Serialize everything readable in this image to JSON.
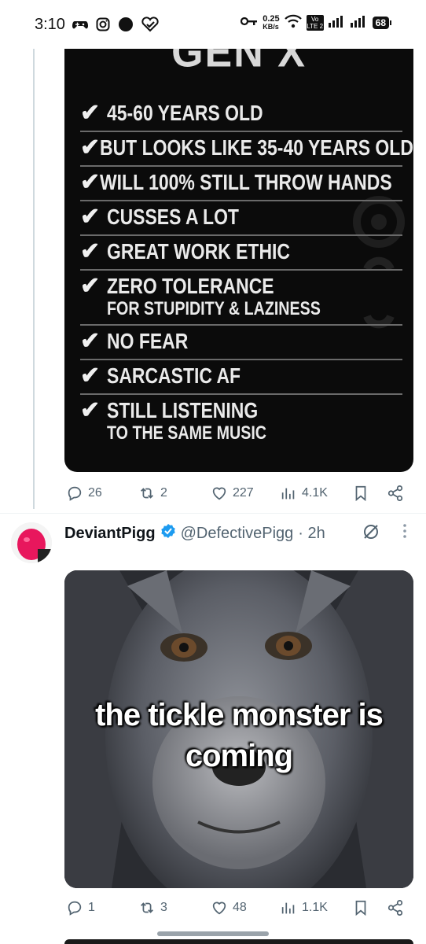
{
  "status_bar": {
    "time": "3:10",
    "net_speed": "0.25\nKB/s",
    "net_speed_value": "0.25",
    "net_speed_unit": "KB/s",
    "volte": "Vo LTE 2",
    "battery": "68"
  },
  "tweet1": {
    "image_heading": "GEN X DEFINED",
    "list": [
      {
        "main": "45-60 YEARS OLD",
        "sub": ""
      },
      {
        "main": "BUT LOOKS LIKE 35-40 YEARS OLD",
        "sub": ""
      },
      {
        "main": "WILL 100% STILL THROW HANDS",
        "sub": ""
      },
      {
        "main": "CUSSES A LOT",
        "sub": ""
      },
      {
        "main": "GREAT WORK ETHIC",
        "sub": ""
      },
      {
        "main": "ZERO TOLERANCE",
        "sub": "FOR STUPIDITY & LAZINESS"
      },
      {
        "main": "NO FEAR",
        "sub": ""
      },
      {
        "main": "SARCASTIC AF",
        "sub": ""
      },
      {
        "main": "STILL LISTENING",
        "sub": "TO THE SAME MUSIC"
      }
    ],
    "replies": "26",
    "reposts": "2",
    "likes": "227",
    "views": "4.1K"
  },
  "tweet2": {
    "display_name": "DeviantPigg",
    "handle": "@DefectivePigg",
    "time": "· 2h",
    "image_caption_line1": "the tickle monster is",
    "image_caption_line2": "coming",
    "replies": "1",
    "reposts": "3",
    "likes": "48",
    "views": "1.1K"
  },
  "colors": {
    "verified": "#1d9bf0",
    "meta": "#536471",
    "avatar": "#e8175d"
  }
}
